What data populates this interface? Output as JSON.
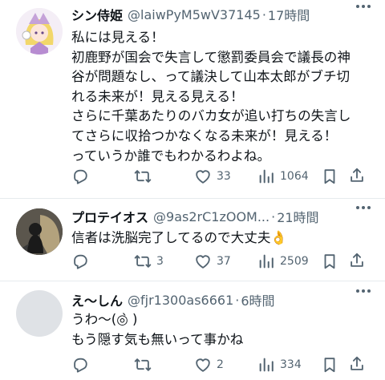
{
  "tweets": [
    {
      "name": "シン侍姫",
      "handle": "@laiwPyM5wV37145",
      "time": "17時間",
      "lines": [
        "私には見える！",
        "初鹿野が国会で失言して懲罰委員会で議長の神",
        "谷が問題なし、って議決して山本太郎がブチ切",
        "れる未来が！見える見える！",
        "さらに千葉あたりのバカ女が追い打ちの失言し",
        "てさらに収拾つかなくなる未来が！見える！",
        "っていうか誰でもわかるわよね。"
      ],
      "reply_count": "",
      "retweet_count": "",
      "like_count": "33",
      "view_count": "1064"
    },
    {
      "name": "プロテイオス",
      "handle": "@9as2rC1zOOM...",
      "time": "21時間",
      "lines": [
        "信者は洗脳完了してるので大丈夫👌"
      ],
      "reply_count": "",
      "retweet_count": "3",
      "like_count": "37",
      "view_count": "2509"
    },
    {
      "name": "え～しん",
      "handle": "@fjr1300as6661",
      "time": "6時間",
      "lines": [
        "うわ～(◎̀ )",
        "もう隠す気も無いって事かね"
      ],
      "reply_count": "",
      "retweet_count": "",
      "like_count": "2",
      "view_count": "334"
    }
  ],
  "icons": {
    "reply": "reply-icon",
    "retweet": "retweet-icon",
    "like": "heart-icon",
    "views": "views-icon",
    "bookmark": "bookmark-icon",
    "share": "share-icon"
  },
  "colors": {
    "text": "#0f1419",
    "secondary": "#536471",
    "divider": "#e6ebee"
  }
}
